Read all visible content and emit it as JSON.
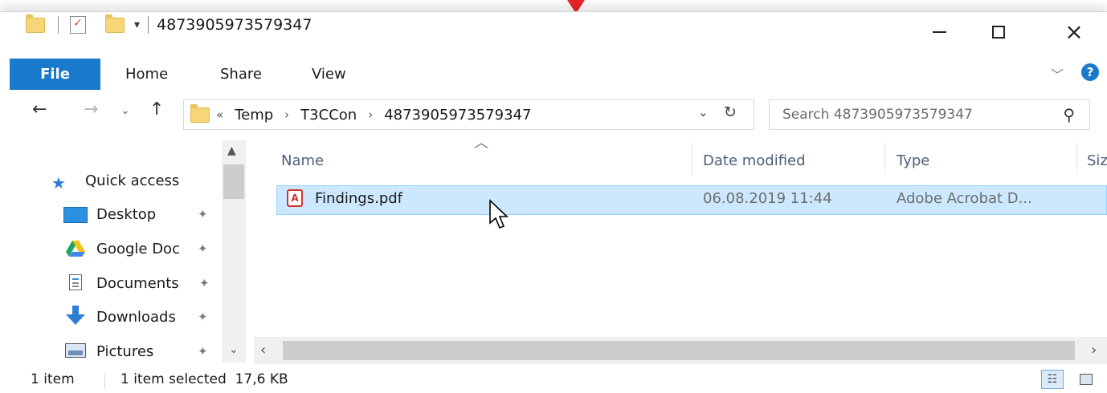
{
  "window": {
    "title": "4873905973579347",
    "controls": {
      "minimize": "minimize-icon",
      "maximize": "maximize-icon",
      "close": "close-icon"
    }
  },
  "ribbon": {
    "tabs": [
      {
        "label": "File",
        "active": true
      },
      {
        "label": "Home"
      },
      {
        "label": "Share"
      },
      {
        "label": "View"
      }
    ],
    "help_label": "?"
  },
  "address": {
    "overflow": "«",
    "crumbs": [
      "Temp",
      "T3CCon",
      "4873905973579347"
    ]
  },
  "search": {
    "placeholder": "Search 4873905973579347"
  },
  "nav_pane": {
    "items": [
      {
        "label": "Quick access",
        "icon": "star-icon"
      },
      {
        "label": "Desktop",
        "icon": "desktop-icon",
        "pinned": true
      },
      {
        "label": "Google Doc",
        "icon": "google-drive-icon",
        "pinned": true
      },
      {
        "label": "Documents",
        "icon": "documents-icon",
        "pinned": true
      },
      {
        "label": "Downloads",
        "icon": "download-arrow-icon",
        "pinned": true
      },
      {
        "label": "Pictures",
        "icon": "pictures-icon",
        "pinned": true
      }
    ]
  },
  "columns": {
    "name": "Name",
    "date": "Date modified",
    "type": "Type",
    "size": "Siz"
  },
  "files": [
    {
      "name": "Findings.pdf",
      "date": "06.08.2019 11:44",
      "type": "Adobe Acrobat D...",
      "selected": true
    }
  ],
  "status": {
    "count": "1 item",
    "selection": "1 item selected  17,6 KB"
  },
  "colors": {
    "accent": "#1979ca",
    "selection_bg": "#cce8ff",
    "selection_border": "#99d1ff",
    "marker": "#e8262b"
  }
}
